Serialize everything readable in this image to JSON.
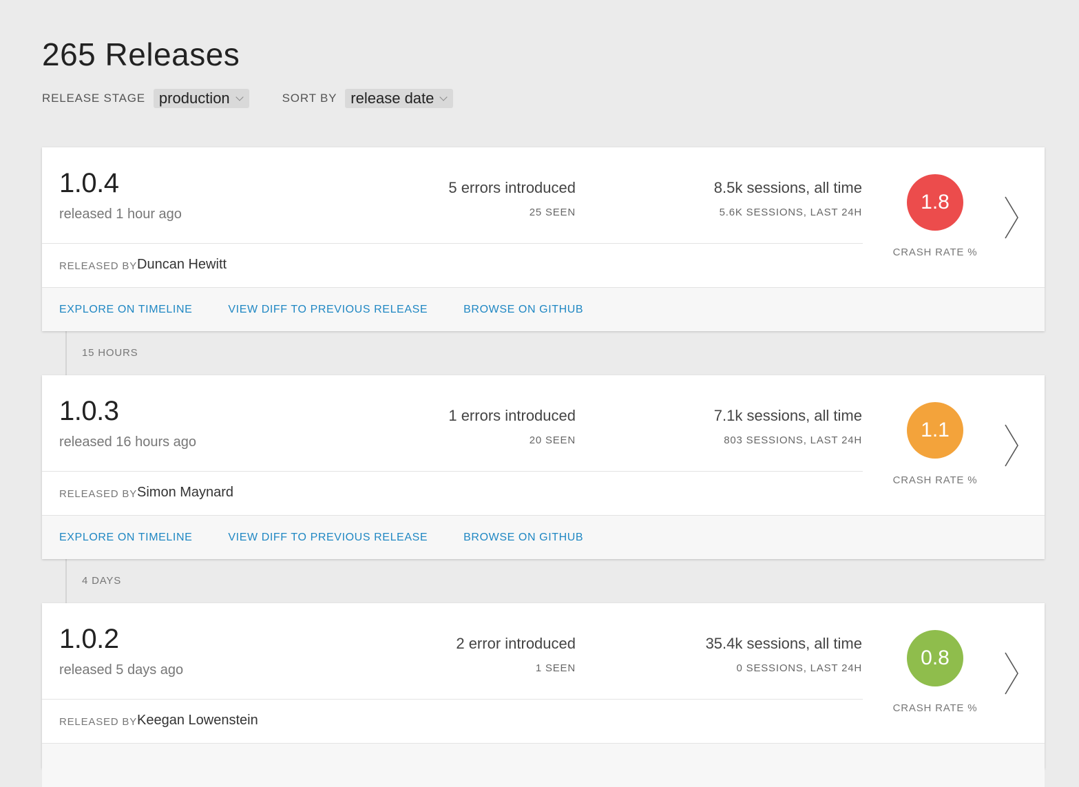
{
  "page_title": "265 Releases",
  "filters": {
    "release_stage_label": "RELEASE STAGE",
    "release_stage_value": "production",
    "sort_label": "SORT BY",
    "sort_value": "release date"
  },
  "colors": {
    "crash_high": "#ec4c4c",
    "crash_medium": "#f3a33b",
    "crash_low": "#8fbd4c",
    "link": "#1f87c3"
  },
  "releases": [
    {
      "version": "1.0.4",
      "released": "released 1 hour ago",
      "errors": "5 errors introduced",
      "errors_seen": "25 SEEN",
      "sessions": "8.5k sessions, all time",
      "sessions_24h": "5.6K SESSIONS, LAST 24H",
      "crash_rate": "1.8",
      "crash_label": "CRASH RATE %",
      "released_by_label": "RELEASED BY",
      "released_by": "Duncan Hewitt",
      "actions": [
        "EXPLORE ON TIMELINE",
        "VIEW DIFF TO PREVIOUS RELEASE",
        "BROWSE ON GITHUB"
      ]
    },
    {
      "version": "1.0.3",
      "released": "released 16 hours ago",
      "errors": "1 errors introduced",
      "errors_seen": "20 SEEN",
      "sessions": "7.1k sessions, all time",
      "sessions_24h": "803 SESSIONS, LAST 24H",
      "crash_rate": "1.1",
      "crash_label": "CRASH RATE %",
      "released_by_label": "RELEASED BY",
      "released_by": "Simon Maynard",
      "actions": [
        "EXPLORE ON TIMELINE",
        "VIEW DIFF TO PREVIOUS RELEASE",
        "BROWSE ON GITHUB"
      ]
    },
    {
      "version": "1.0.2",
      "released": "released 5 days ago",
      "errors": "2 error introduced",
      "errors_seen": "1 SEEN",
      "sessions": "35.4k sessions, all time",
      "sessions_24h": "0 SESSIONS, LAST 24H",
      "crash_rate": "0.8",
      "crash_label": "CRASH RATE %",
      "released_by_label": "RELEASED BY",
      "released_by": "Keegan Lowenstein"
    }
  ],
  "gaps": [
    "15 HOURS",
    "4 DAYS"
  ]
}
